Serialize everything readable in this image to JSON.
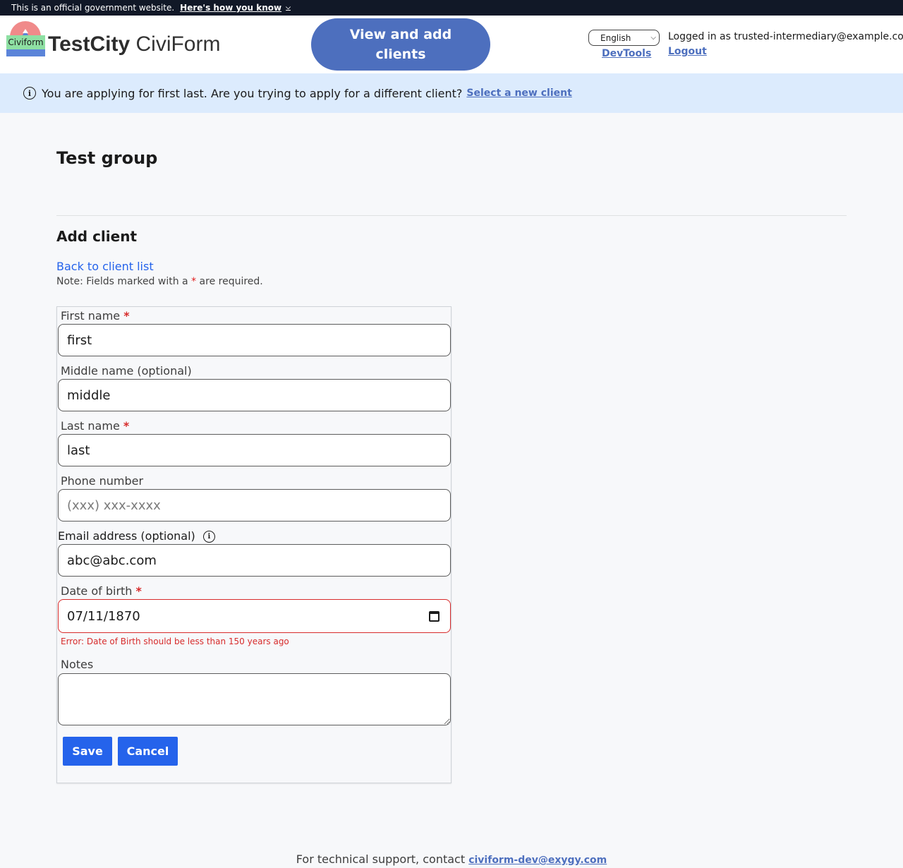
{
  "gov_banner": {
    "text": "This is an official government website.",
    "link": "Here's how you know",
    "link_icon": "chevron-down-icon"
  },
  "header": {
    "logo_text": "Civiform",
    "city": "TestCity",
    "app": "CiviForm",
    "clients_button": "View and add clients",
    "language": "English",
    "devtools": "DevTools",
    "logged_in": "Logged in as trusted-intermediary@example.com",
    "logout": "Logout"
  },
  "applying_banner": {
    "icon": "info-icon",
    "text": "You are applying for first last. Are you trying to apply for a different client?",
    "link": "Select a new client"
  },
  "main": {
    "group_title": "Test group",
    "section_title": "Add client",
    "back_link": "Back to client list",
    "note_prefix": "Note: Fields marked with a",
    "note_star": "*",
    "note_suffix": "are required."
  },
  "form": {
    "first_name": {
      "label": "First name",
      "required": "*",
      "value": "first"
    },
    "middle_name": {
      "label": "Middle name (optional)",
      "value": "middle"
    },
    "last_name": {
      "label": "Last name",
      "required": "*",
      "value": "last"
    },
    "phone": {
      "label": "Phone number",
      "value": "",
      "placeholder": "(xxx) xxx-xxxx"
    },
    "email": {
      "label": "Email address (optional)",
      "value": "abc@abc.com",
      "icon": "info-icon"
    },
    "dob": {
      "label": "Date of birth",
      "required": "*",
      "value": "07/11/1870",
      "error": "Error: Date of Birth should be less than 150 years ago",
      "icon": "calendar-icon"
    },
    "notes": {
      "label": "Notes",
      "value": ""
    },
    "save": "Save",
    "cancel": "Cancel"
  },
  "footer": {
    "text": "For technical support, contact",
    "email": "civiform-dev@exygy.com"
  },
  "colors": {
    "gov_banner": "#111827",
    "brand_blue": "#4d6fbe",
    "button_blue": "#2563eb",
    "info_banner": "#dcebfd",
    "error_red": "#d72b2b"
  }
}
